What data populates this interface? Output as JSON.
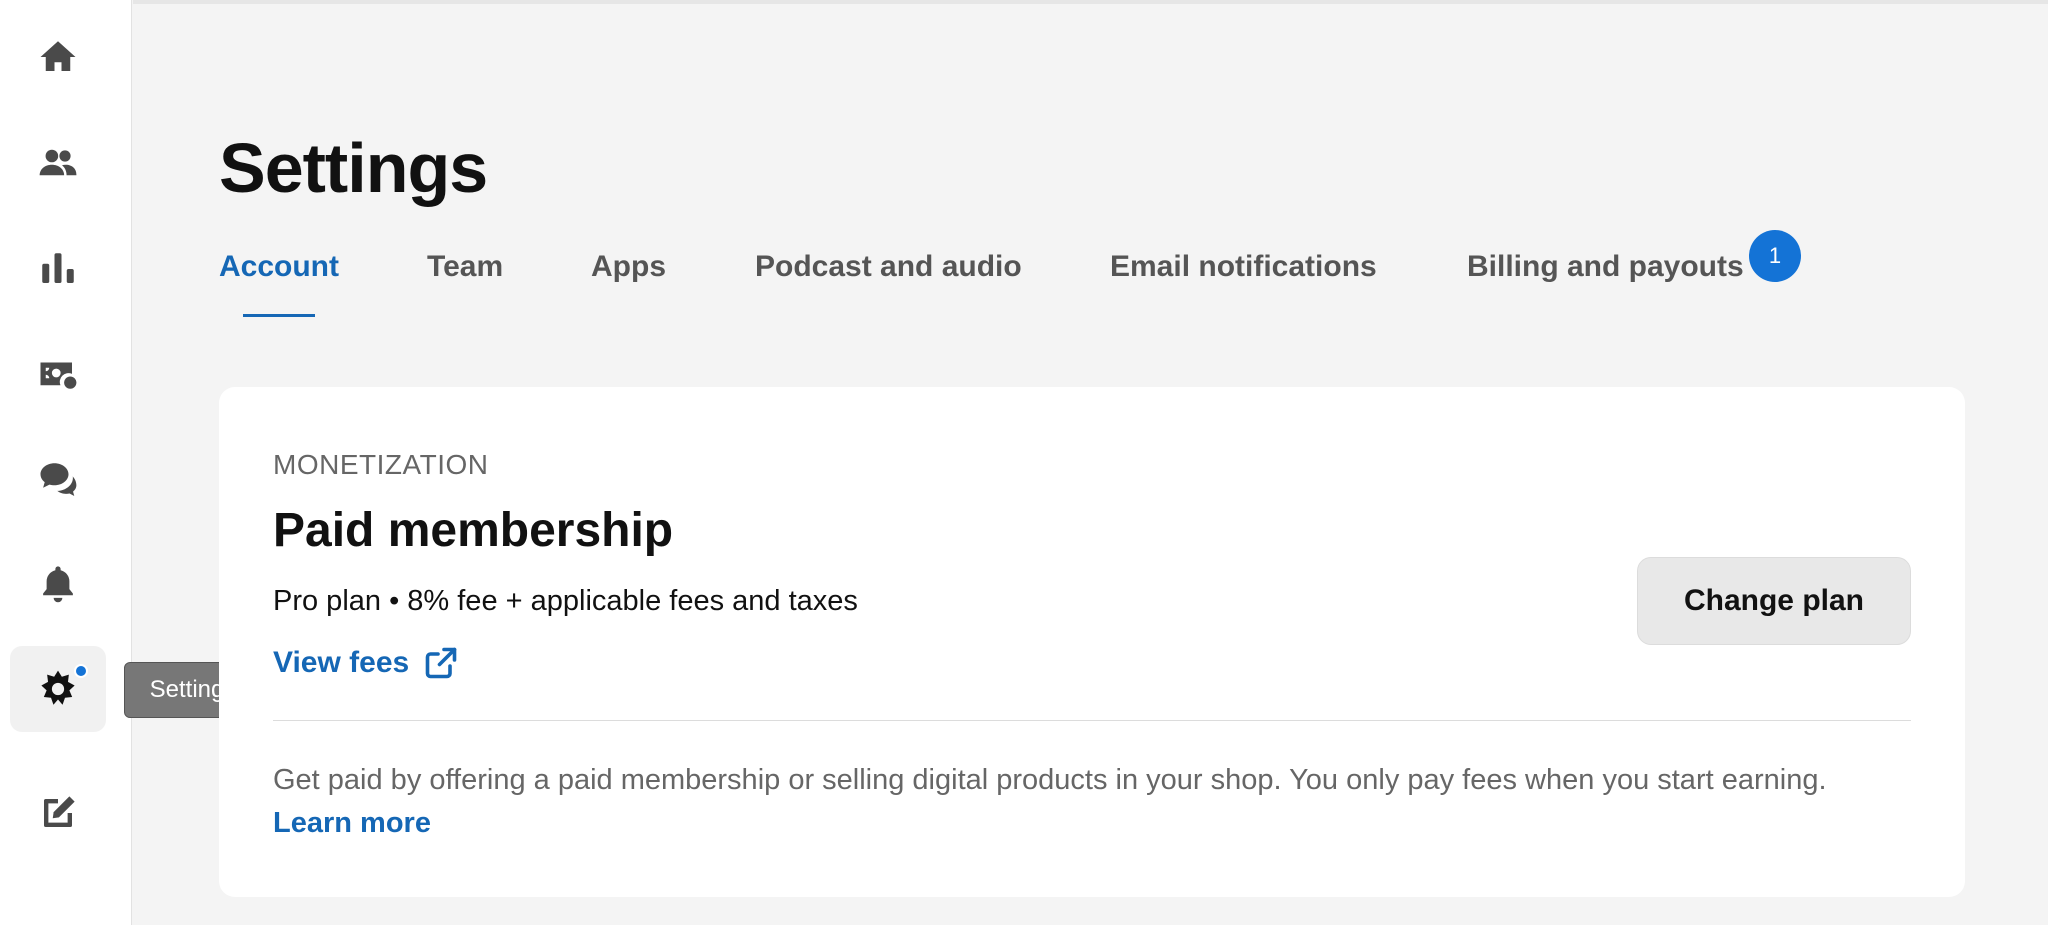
{
  "sidebar": {
    "items": [
      {
        "name": "home",
        "icon": "home-icon"
      },
      {
        "name": "subscribers",
        "icon": "people-icon"
      },
      {
        "name": "stats",
        "icon": "bar-chart-icon"
      },
      {
        "name": "money",
        "icon": "money-icon"
      },
      {
        "name": "chat",
        "icon": "chat-bubbles-icon"
      },
      {
        "name": "notifications",
        "icon": "bell-icon"
      },
      {
        "name": "settings",
        "icon": "gear-icon",
        "active": true
      },
      {
        "name": "write",
        "icon": "edit-icon"
      }
    ],
    "tooltip": "Settings"
  },
  "page": {
    "title": "Settings"
  },
  "tabs": [
    {
      "label": "Account",
      "active": true
    },
    {
      "label": "Team"
    },
    {
      "label": "Apps"
    },
    {
      "label": "Podcast and audio"
    },
    {
      "label": "Email notifications"
    },
    {
      "label": "Billing and payouts",
      "badge": "1"
    }
  ],
  "card": {
    "eyebrow": "MONETIZATION",
    "title": "Paid membership",
    "plan": "Pro plan • 8% fee + applicable fees and taxes",
    "view_fees": "View fees",
    "change_plan": "Change plan",
    "description": "Get paid by offering a paid membership or selling digital products in your shop. You only pay fees when you start earning.",
    "learn_more": "Learn more"
  },
  "colors": {
    "accent": "#1567b5",
    "badge": "#1473d6",
    "background": "#f4f4f4"
  }
}
